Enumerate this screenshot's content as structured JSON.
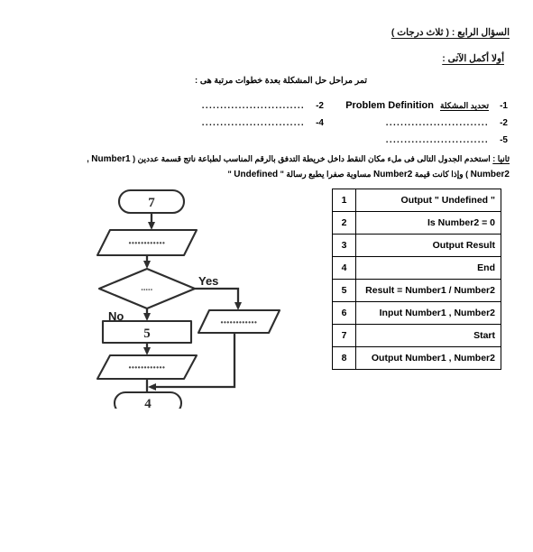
{
  "header": {
    "question_line": "السؤال الرابع :  ( ثلاث درجات )",
    "first_part_label": "أولا   أكمل الآتى  :"
  },
  "intro": {
    "sentence": "تمر مراحل حل المشكلة بعدة خطوات مرتبة هى :"
  },
  "steps": {
    "right_column": [
      {
        "num": "-1",
        "arabic": "تحديد المشكلة",
        "english": "Problem Definition",
        "dots": ""
      },
      {
        "num": "-2",
        "arabic": "",
        "english": "",
        "dots": "............................"
      },
      {
        "num": "-5",
        "arabic": "",
        "english": "",
        "dots": "............................"
      }
    ],
    "left_column": [
      {
        "num": "-2",
        "arabic": "",
        "english": "",
        "dots": "............................"
      },
      {
        "num": "-4",
        "arabic": "",
        "english": "",
        "dots": "............................"
      }
    ]
  },
  "instruction": {
    "label": "ثانيا :",
    "line1_a": "استخدم الجدول التالى فى ملء مكان النقط داخل خريطة التدفق بالرقم المناسب لطباعة ناتج قسمة عددين  (",
    "line1_b": "Number1",
    "line1_c": ",",
    "line2_a": "Number2",
    "line2_b": ") وإذا كانت قيمة",
    "line2_c": "Number2",
    "line2_d": "مساوية صفرا يطبع رسالة \"",
    "line2_e": "Undefined",
    "line2_f": "\""
  },
  "table": {
    "rows": [
      {
        "index": "1",
        "value": "Output \" Undefined \""
      },
      {
        "index": "2",
        "value": "Is Number2 = 0"
      },
      {
        "index": "3",
        "value": "Output Result"
      },
      {
        "index": "4",
        "value": "End"
      },
      {
        "index": "5",
        "value": "Result = Number1 /  Number2"
      },
      {
        "index": "6",
        "value": "Input Number1 , Number2"
      },
      {
        "index": "7",
        "value": "Start"
      },
      {
        "index": "8",
        "value": "Output Number1 , Number2"
      }
    ]
  },
  "flowchart": {
    "start_terminal": "7",
    "input_shape_dots": "••••••••••••",
    "decision_dots": "•••••",
    "branch_yes_label": "Yes",
    "branch_no_label": "No",
    "process_box": "5",
    "output_shape_dots": "••••••••••••",
    "right_output_dots": "••••••••••••",
    "end_terminal": "4"
  }
}
